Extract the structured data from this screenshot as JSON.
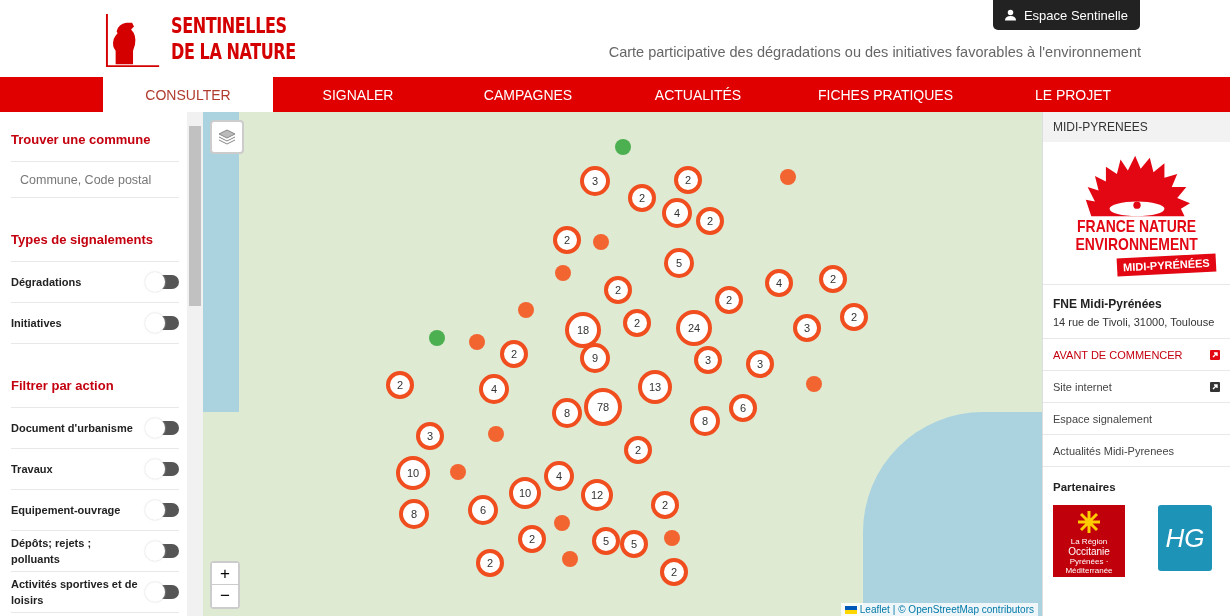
{
  "header": {
    "logo_lines": [
      "SENTINELLES",
      "DE LA NATURE"
    ],
    "account_button": "Espace Sentinelle",
    "tagline": "Carte participative des dégradations ou des initiatives favorables à l'environnement"
  },
  "nav": [
    {
      "label": "CONSULTER",
      "selected": true
    },
    {
      "label": "SIGNALER",
      "selected": false
    },
    {
      "label": "CAMPAGNES",
      "selected": false
    },
    {
      "label": "ACTUALITÉS",
      "selected": false
    },
    {
      "label": "FICHES PRATIQUES",
      "selected": false
    },
    {
      "label": "LE PROJET",
      "selected": false
    }
  ],
  "sidebar": {
    "search_title": "Trouver une commune",
    "search": {
      "placeholder": "Commune, Code postal"
    },
    "sections": [
      {
        "title": "Types de signalements",
        "items": [
          {
            "label": "Dégradations",
            "on": false
          },
          {
            "label": "Initiatives",
            "on": false
          }
        ]
      },
      {
        "title": "Filtrer par action",
        "items": [
          {
            "label": "Document d'urbanisme",
            "on": false
          },
          {
            "label": "Travaux",
            "on": false
          },
          {
            "label": "Equipement-ouvrage",
            "on": false
          },
          {
            "label": "Dépôts; rejets ; polluants",
            "on": false
          },
          {
            "label": "Activités sportives et de loisirs",
            "on": false
          }
        ]
      }
    ]
  },
  "map": {
    "zoom_in": "+",
    "zoom_out": "−",
    "attribution_link": "Leaflet",
    "attribution_text": "| © OpenStreetMap contributors",
    "markers": [
      {
        "kind": "dot",
        "color": "#4caf50"
      },
      {
        "kind": "cluster",
        "count": "3"
      },
      {
        "kind": "cluster",
        "count": "2"
      },
      {
        "kind": "dot",
        "color": "#f26430"
      },
      {
        "kind": "cluster",
        "count": "2"
      },
      {
        "kind": "cluster",
        "count": "4"
      },
      {
        "kind": "cluster",
        "count": "2"
      },
      {
        "kind": "cluster",
        "count": "2"
      },
      {
        "kind": "dot",
        "color": "#f26430"
      },
      {
        "kind": "cluster",
        "count": "5"
      },
      {
        "kind": "dot",
        "color": "#f26430"
      },
      {
        "kind": "cluster",
        "count": "4"
      },
      {
        "kind": "cluster",
        "count": "2"
      },
      {
        "kind": "cluster",
        "count": "2"
      },
      {
        "kind": "cluster",
        "count": "2"
      },
      {
        "kind": "dot",
        "color": "#f26430"
      },
      {
        "kind": "cluster",
        "count": "18"
      },
      {
        "kind": "cluster",
        "count": "2"
      },
      {
        "kind": "cluster",
        "count": "24"
      },
      {
        "kind": "cluster",
        "count": "3"
      },
      {
        "kind": "cluster",
        "count": "2"
      },
      {
        "kind": "dot",
        "color": "#4caf50"
      },
      {
        "kind": "dot",
        "color": "#f26430"
      },
      {
        "kind": "cluster",
        "count": "2"
      },
      {
        "kind": "cluster",
        "count": "9"
      },
      {
        "kind": "cluster",
        "count": "3"
      },
      {
        "kind": "cluster",
        "count": "3"
      },
      {
        "kind": "cluster",
        "count": "2"
      },
      {
        "kind": "cluster",
        "count": "4"
      },
      {
        "kind": "cluster",
        "count": "13"
      },
      {
        "kind": "dot",
        "color": "#f26430"
      },
      {
        "kind": "cluster",
        "count": "8"
      },
      {
        "kind": "cluster",
        "count": "78"
      },
      {
        "kind": "cluster",
        "count": "8"
      },
      {
        "kind": "cluster",
        "count": "6"
      },
      {
        "kind": "cluster",
        "count": "3"
      },
      {
        "kind": "dot",
        "color": "#f26430"
      },
      {
        "kind": "cluster",
        "count": "2"
      },
      {
        "kind": "cluster",
        "count": "10"
      },
      {
        "kind": "dot",
        "color": "#f26430"
      },
      {
        "kind": "cluster",
        "count": "4"
      },
      {
        "kind": "cluster",
        "count": "10"
      },
      {
        "kind": "cluster",
        "count": "12"
      },
      {
        "kind": "cluster",
        "count": "8"
      },
      {
        "kind": "cluster",
        "count": "6"
      },
      {
        "kind": "cluster",
        "count": "2"
      },
      {
        "kind": "dot",
        "color": "#f26430"
      },
      {
        "kind": "cluster",
        "count": "2"
      },
      {
        "kind": "cluster",
        "count": "5"
      },
      {
        "kind": "cluster",
        "count": "5"
      },
      {
        "kind": "dot",
        "color": "#f26430"
      },
      {
        "kind": "cluster",
        "count": "2"
      },
      {
        "kind": "dot",
        "color": "#f26430"
      },
      {
        "kind": "cluster",
        "count": "2"
      }
    ]
  },
  "panel": {
    "region": "MIDI-PYRENEES",
    "logo_lines": [
      "FRANCE NATURE",
      "ENVIRONNEMENT"
    ],
    "logo_badge": "MIDI-PYRÉNÉES",
    "org_name": "FNE Midi-Pyrénées",
    "address": "14 rue de Tivoli, 31000, Toulouse",
    "links": [
      {
        "label": "AVANT DE COMMENCER",
        "kind": "highlight"
      },
      {
        "label": "Site internet",
        "kind": "external"
      },
      {
        "label": "Espace signalement",
        "kind": "plain"
      },
      {
        "label": "Actualités Midi-Pyrenees",
        "kind": "plain"
      }
    ],
    "partners_title": "Partenaires",
    "partner_region": {
      "small": "La Région",
      "name": "Occitanie",
      "sub": "Pyrénées · Méditerranée"
    },
    "partner_dept": {
      "name": "HG"
    }
  }
}
